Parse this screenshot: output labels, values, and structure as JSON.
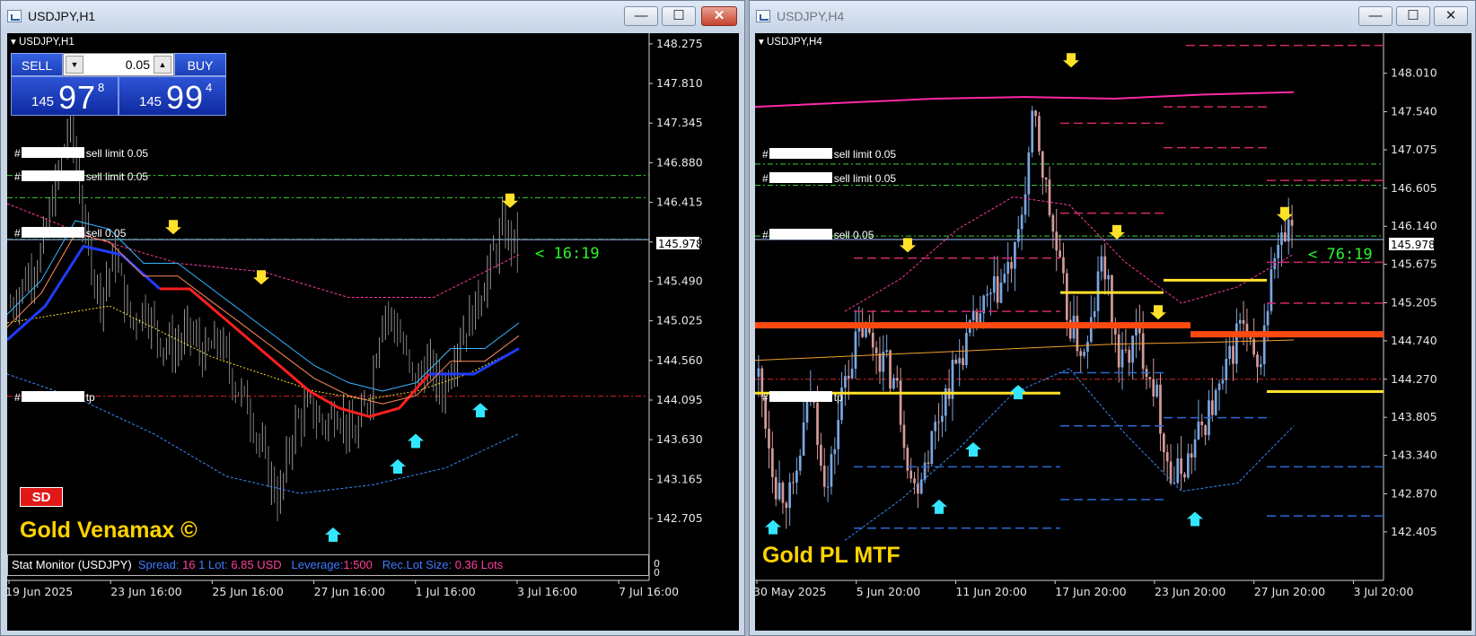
{
  "colors": {
    "bull": "#7aa6e0",
    "bear": "#d39a9a",
    "ma_red": "#ff1f1f",
    "ma_blue": "#1f3cff",
    "level_orange": "#ff4a12",
    "level_yellow": "#ffe12a",
    "countdown": "#2cf52c",
    "brand": "#ffd400"
  },
  "left": {
    "window_title": "USDJPY,H1",
    "symbol_label": "USDJPY,H1",
    "trade": {
      "sell_label": "SELL",
      "buy_label": "BUY",
      "lot": "0.05",
      "bid_prefix": "145",
      "bid_big": "97",
      "bid_sup": "8",
      "ask_prefix": "145",
      "ask_big": "99",
      "ask_sup": "4"
    },
    "orders": [
      {
        "mark": "#",
        "text": "sell limit 0.05"
      },
      {
        "mark": "#",
        "text": "sell limit 0.05"
      },
      {
        "mark": "#",
        "text": "sell 0.05"
      },
      {
        "mark": "#",
        "text": "tp"
      }
    ],
    "countdown": "< 16:19",
    "current_price": "145.978",
    "badge": "SD",
    "brand": "Gold Venamax ©",
    "stat": {
      "title": "Stat Monitor (USDJPY)",
      "spread_k": "Spread:",
      "spread_v": "16",
      "lot_k": "1 Lot:",
      "lot_v": "6.85 USD",
      "lev_k": "Leverage:",
      "lev_v": "1:500",
      "rec_k": "Rec.Lot Size:",
      "rec_v": "0.36 Lots"
    },
    "stat_scale": [
      "0",
      "0"
    ]
  },
  "right": {
    "window_title": "USDJPY,H4",
    "symbol_label": "USDJPY,H4",
    "orders": [
      {
        "mark": "#",
        "text": "sell limit 0.05"
      },
      {
        "mark": "#",
        "text": "sell limit 0.05"
      },
      {
        "mark": "#",
        "text": "sell 0.05"
      },
      {
        "mark": "#",
        "text": "tp"
      }
    ],
    "countdown": "< 76:19",
    "current_price": "145.978",
    "brand": "Gold PL MTF"
  },
  "chart_data": [
    {
      "type": "candlestick",
      "symbol": "USDJPY",
      "timeframe": "H1",
      "ylim": [
        142.4,
        148.4
      ],
      "y_ticks": [
        148.275,
        147.81,
        147.345,
        146.88,
        146.415,
        145.95,
        145.49,
        145.025,
        144.56,
        144.095,
        143.63,
        143.165,
        142.705
      ],
      "x_ticks": [
        "19 Jun 2025",
        "23 Jun 16:00",
        "25 Jun 16:00",
        "27 Jun 16:00",
        "1 Jul 16:00",
        "3 Jul 16:00",
        "7 Jul 16:00"
      ],
      "price_path": [
        145.2,
        145.5,
        145.8,
        146.6,
        147.4,
        146.0,
        145.3,
        145.8,
        145.0,
        145.2,
        144.8,
        144.7,
        144.9,
        144.6,
        144.8,
        144.3,
        144.0,
        143.4,
        142.9,
        143.8,
        144.0,
        143.8,
        144.0,
        143.6,
        144.1,
        145.2,
        144.9,
        144.3,
        144.5,
        144.2,
        144.8,
        145.1,
        145.6,
        146.1,
        145.9
      ],
      "current_price": 145.978,
      "levels": [
        {
          "label": "sell limit 0.05",
          "price": 146.73
        },
        {
          "label": "sell limit 0.05",
          "price": 146.47
        },
        {
          "label": "sell 0.05",
          "price": 145.98
        },
        {
          "label": "tp",
          "price": 144.14
        }
      ],
      "ma_fast": [
        144.8,
        145.2,
        145.9,
        145.8,
        145.4,
        145.4,
        145.1,
        144.8,
        144.5,
        144.2,
        144.0,
        143.9,
        144.0,
        144.4,
        144.4,
        144.7
      ],
      "ma_slow": [
        145.0,
        145.1,
        145.2,
        144.9,
        144.6,
        144.4,
        144.2,
        144.1,
        144.2,
        144.4,
        144.7
      ],
      "env_upper": [
        146.4,
        146.0,
        145.7,
        145.6,
        145.3,
        145.3,
        145.8
      ],
      "env_lower": [
        144.4,
        144.1,
        143.7,
        143.2,
        143.0,
        143.1,
        143.3,
        143.7
      ],
      "arrows": [
        {
          "dir": "down",
          "price": 146.35
        },
        {
          "dir": "down",
          "price": 146.04
        },
        {
          "dir": "down",
          "price": 145.45
        },
        {
          "dir": "up",
          "price": 144.06
        },
        {
          "dir": "up",
          "price": 143.7
        },
        {
          "dir": "up",
          "price": 143.4
        },
        {
          "dir": "up",
          "price": 142.6
        }
      ]
    },
    {
      "type": "candlestick",
      "symbol": "USDJPY",
      "timeframe": "H4",
      "ylim": [
        142.25,
        148.5
      ],
      "y_ticks": [
        148.01,
        147.54,
        147.075,
        146.605,
        146.14,
        145.675,
        145.205,
        144.74,
        144.27,
        143.805,
        143.34,
        142.87,
        142.405
      ],
      "x_ticks": [
        "30 May 2025",
        "5 Jun 20:00",
        "11 Jun 20:00",
        "17 Jun 20:00",
        "23 Jun 20:00",
        "27 Jun 20:00",
        "3 Jul 20:00"
      ],
      "price_path": [
        144.3,
        143.0,
        142.8,
        144.2,
        142.9,
        144.3,
        144.9,
        144.6,
        144.2,
        142.9,
        143.5,
        144.2,
        144.7,
        145.1,
        145.4,
        145.8,
        147.5,
        146.2,
        145.0,
        144.5,
        145.8,
        144.4,
        144.8,
        144.2,
        143.0,
        143.3,
        143.8,
        144.2,
        145.0,
        144.3,
        145.8,
        146.1
      ],
      "current_price": 145.978,
      "levels": [
        {
          "label": "sell limit 0.05",
          "price": 146.9
        },
        {
          "label": "sell limit 0.05",
          "price": 146.64
        },
        {
          "label": "sell 0.05",
          "price": 146.02
        },
        {
          "label": "tp",
          "price": 144.27
        }
      ],
      "thick_levels": [
        144.93,
        144.82
      ],
      "yellow_levels": [
        144.1,
        145.33,
        145.48,
        144.12
      ],
      "ma_magenta": [
        147.6,
        147.65,
        147.7,
        147.72,
        147.7,
        147.75,
        147.78
      ],
      "arrows": [
        {
          "dir": "down",
          "price": 148.08
        },
        {
          "dir": "down",
          "price": 145.82
        },
        {
          "dir": "down",
          "price": 145.98
        },
        {
          "dir": "down",
          "price": 145.0
        },
        {
          "dir": "down",
          "price": 146.2
        },
        {
          "dir": "up",
          "price": 144.2
        },
        {
          "dir": "up",
          "price": 143.5
        },
        {
          "dir": "up",
          "price": 142.8
        },
        {
          "dir": "up",
          "price": 142.65
        },
        {
          "dir": "up",
          "price": 142.55
        }
      ]
    }
  ]
}
